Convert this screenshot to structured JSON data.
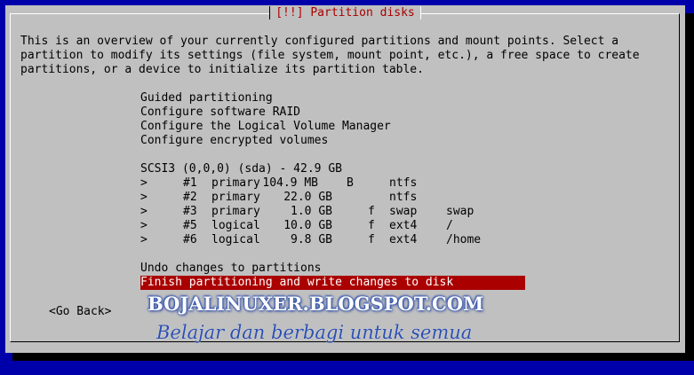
{
  "dialog": {
    "title": "[!!] Partition disks",
    "intro_lines": [
      "This is an overview of your currently configured partitions and mount points. Select a",
      "partition to modify its settings (file system, mount point, etc.), a free space to create",
      "partitions, or a device to initialize its partition table."
    ]
  },
  "menu": {
    "guided": "Guided partitioning",
    "raid": "Configure software RAID",
    "lvm": "Configure the Logical Volume Manager",
    "encrypted": "Configure encrypted volumes",
    "disk": "SCSI3 (0,0,0) (sda) - 42.9 GB",
    "partitions": [
      {
        "arrow": ">",
        "num": "#1",
        "type": "primary",
        "size": "104.9 MB",
        "flag": "B",
        "fs_flag": "",
        "fs": "ntfs",
        "mount": ""
      },
      {
        "arrow": ">",
        "num": "#2",
        "type": "primary",
        "size": "22.0 GB",
        "flag": "",
        "fs_flag": "",
        "fs": "ntfs",
        "mount": ""
      },
      {
        "arrow": ">",
        "num": "#3",
        "type": "primary",
        "size": "1.0 GB",
        "flag": "",
        "fs_flag": "f",
        "fs": "swap",
        "mount": "swap"
      },
      {
        "arrow": ">",
        "num": "#5",
        "type": "logical",
        "size": "10.0 GB",
        "flag": "",
        "fs_flag": "f",
        "fs": "ext4",
        "mount": "/"
      },
      {
        "arrow": ">",
        "num": "#6",
        "type": "logical",
        "size": "9.8 GB",
        "flag": "",
        "fs_flag": "f",
        "fs": "ext4",
        "mount": "/home"
      }
    ],
    "undo": "Undo changes to partitions",
    "finish": "Finish partitioning and write changes to disk"
  },
  "go_back": "<Go Back>",
  "watermark": {
    "site": "BOJALINUXER.BLOGSPOT.COM",
    "tagline": "Belajar dan berbagi untuk semua"
  },
  "colors": {
    "background": "#0000aa",
    "dialog": "#c0c0c0",
    "highlight": "#aa0000",
    "title": "#aa0000"
  }
}
